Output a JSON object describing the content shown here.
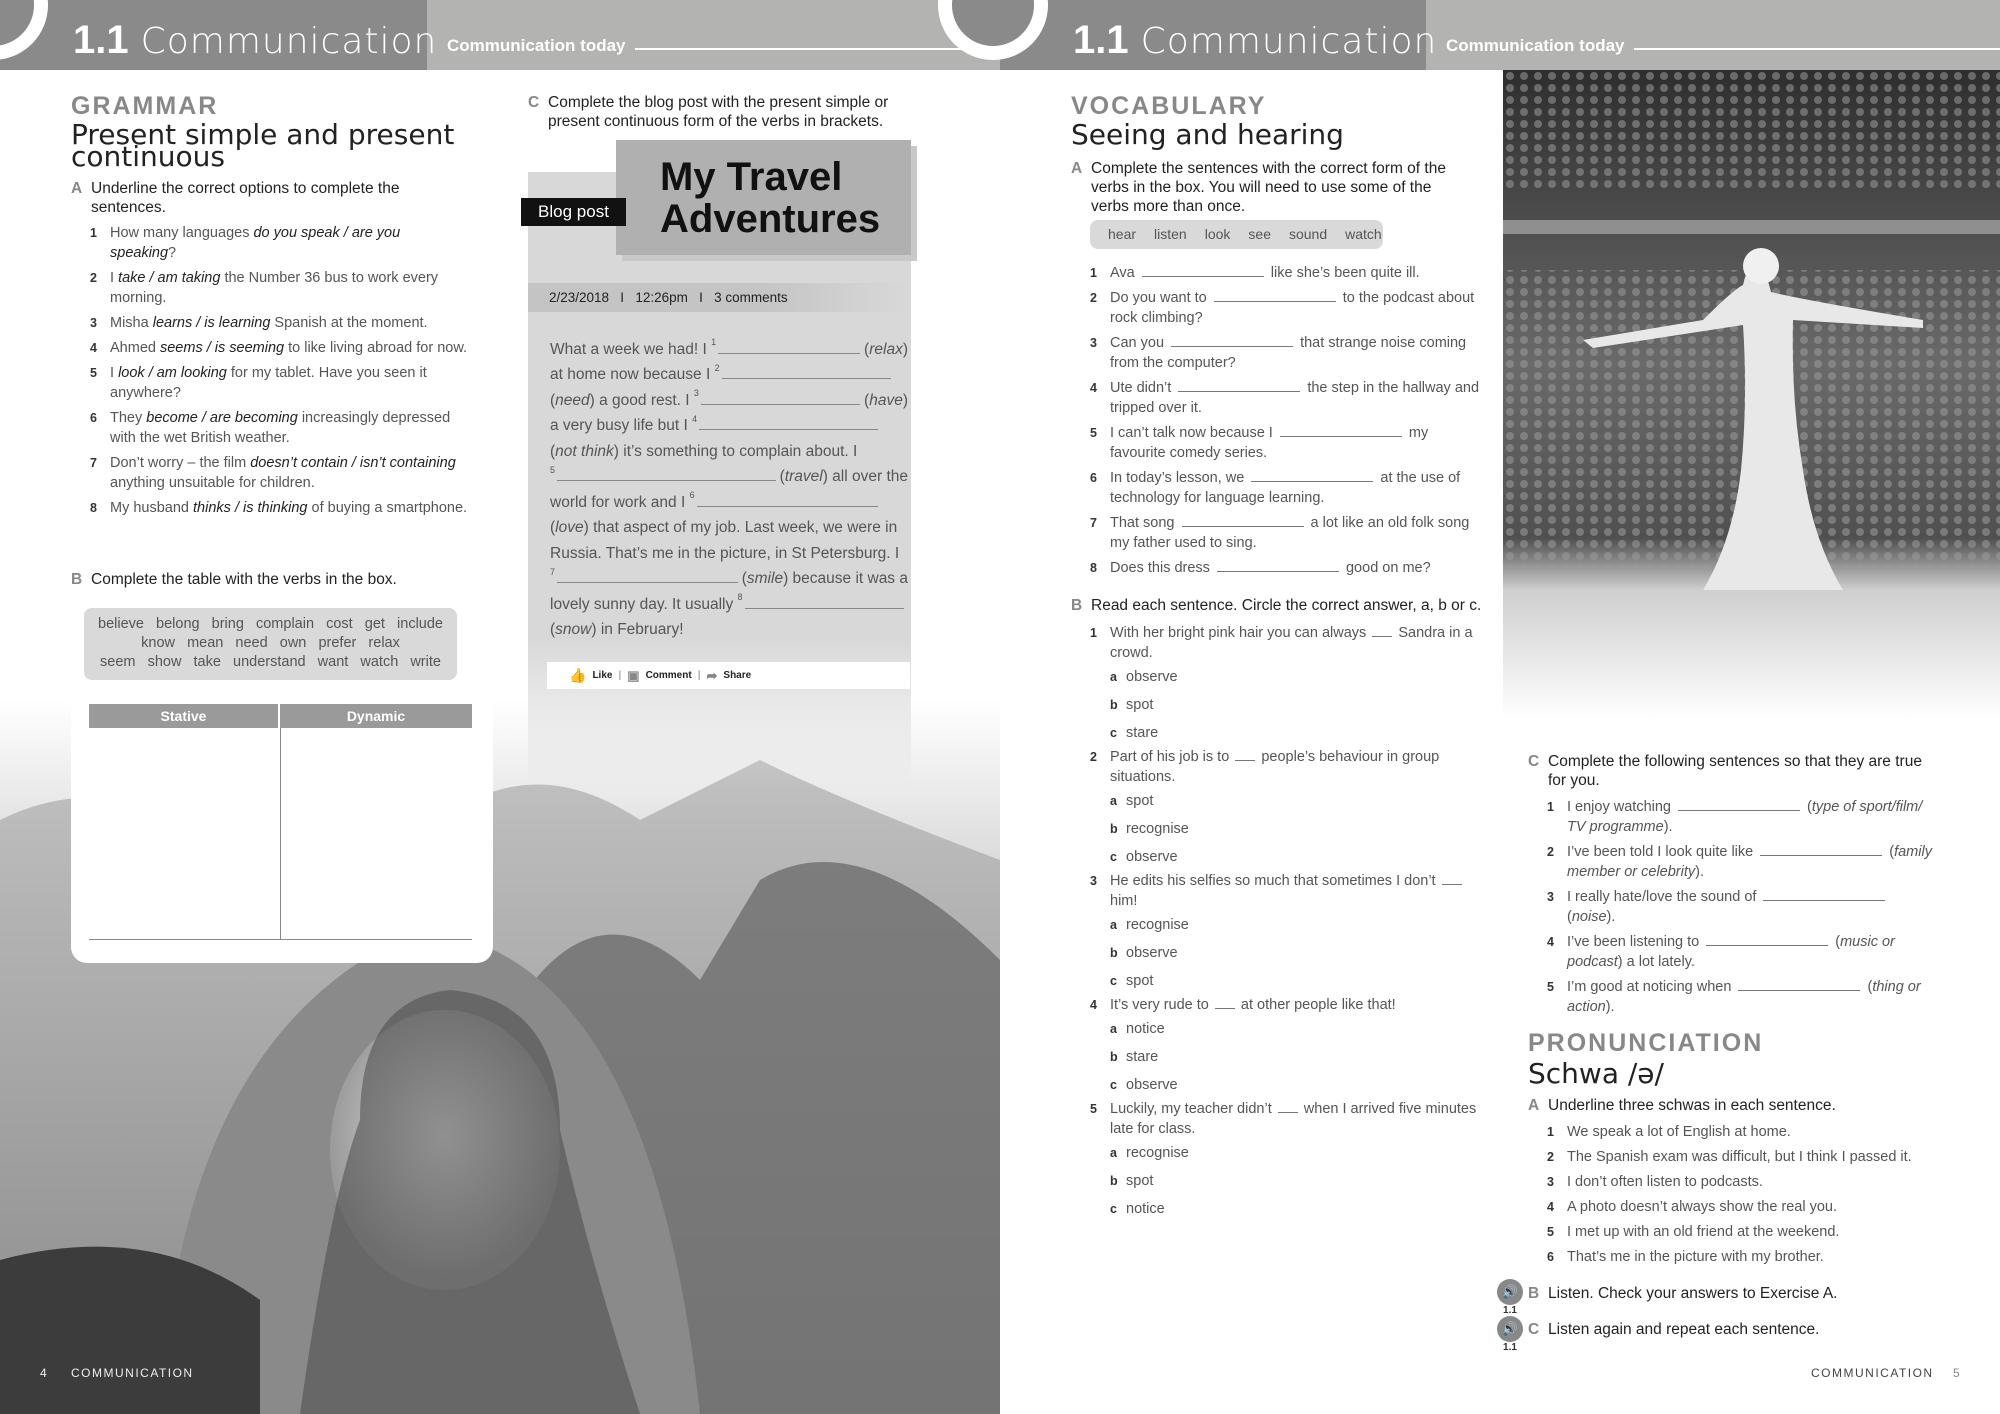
{
  "header": {
    "unit": "1.1",
    "title": "Communication",
    "subtitle": "Communication today"
  },
  "grammar": {
    "section": "GRAMMAR",
    "title_lines": [
      "Present simple and present",
      "continuous"
    ],
    "A": {
      "letter": "A",
      "text": "Underline the correct options to complete the  sentences.",
      "items": [
        {
          "pre": "How many languages ",
          "opt": "do you speak / are you speaking",
          "post": "?"
        },
        {
          "pre": "I ",
          "opt": "take / am taking",
          "post": " the Number 36 bus to work every morning."
        },
        {
          "pre": "Misha ",
          "opt": "learns / is learning",
          "post": " Spanish at the moment."
        },
        {
          "pre": "Ahmed ",
          "opt": "seems / is seeming",
          "post": " to like living abroad for now."
        },
        {
          "pre": "I ",
          "opt": "look / am looking",
          "post": " for my tablet. Have you seen it anywhere?"
        },
        {
          "pre": "They ",
          "opt": "become / are becoming",
          "post": " increasingly depressed with the wet British weather."
        },
        {
          "pre": "Don’t worry – the film ",
          "opt": "doesn’t contain / isn’t containing",
          "post": " anything unsuitable for children."
        },
        {
          "pre": "My husband ",
          "opt": "thinks / is thinking",
          "post": " of buying a smartphone."
        }
      ]
    },
    "B": {
      "letter": "B",
      "text": "Complete the table with the verbs in the box.",
      "verb_lines": [
        "believe   belong   bring   complain   cost   get   include",
        "know   mean   need   own   prefer   relax",
        "seem   show   take   understand   want   watch   write"
      ],
      "table_headers": [
        "Stative",
        "Dynamic"
      ]
    },
    "C": {
      "letter": "C",
      "text": "Complete the blog post with the present simple or present continuous form of the verbs in brackets."
    }
  },
  "blog": {
    "tag": "Blog post",
    "title_lines": [
      "My Travel",
      "Adventures"
    ],
    "meta": "2/23/2018   I   12:26pm   I   3 comments",
    "lines": [
      [
        {
          "t": "What a week we had! I "
        },
        {
          "s": "1"
        },
        {
          "g": 1
        },
        {
          "t": "("
        },
        {
          "i": "relax"
        },
        {
          "t": ")"
        }
      ],
      [
        {
          "t": "at home now because I "
        },
        {
          "s": "2"
        },
        {
          "g": 1
        },
        {
          "t": "   "
        }
      ],
      [
        {
          "t": "("
        },
        {
          "i": "need"
        },
        {
          "t": ") a good rest. I "
        },
        {
          "s": "3"
        },
        {
          "g": 1
        },
        {
          "t": "("
        },
        {
          "i": "have"
        },
        {
          "t": ")"
        }
      ],
      [
        {
          "t": "a very busy life but I "
        },
        {
          "s": "4"
        },
        {
          "g": 1
        },
        {
          "t": "      "
        }
      ],
      [
        {
          "t": "("
        },
        {
          "i": "not think"
        },
        {
          "t": ") it’s something to complain about. I"
        }
      ],
      [
        {
          "s": "5"
        },
        {
          "g": 1
        },
        {
          "t": "("
        },
        {
          "i": "travel"
        },
        {
          "t": ") all over the"
        }
      ],
      [
        {
          "t": "world for work and I "
        },
        {
          "s": "6"
        },
        {
          "g": 1
        },
        {
          "t": "      "
        }
      ],
      [
        {
          "t": "("
        },
        {
          "i": "love"
        },
        {
          "t": ") that aspect of my job. Last week, we were in"
        }
      ],
      [
        {
          "t": "Russia. That’s me in the picture, in St Petersburg. I"
        }
      ],
      [
        {
          "s": "7"
        },
        {
          "g": 1
        },
        {
          "t": "("
        },
        {
          "i": "smile"
        },
        {
          "t": ") because it was a"
        }
      ],
      [
        {
          "t": "lovely sunny day. It usually "
        },
        {
          "s": "8"
        },
        {
          "g": 1
        }
      ],
      [
        {
          "t": "("
        },
        {
          "i": "snow"
        },
        {
          "t": ") in February!"
        }
      ]
    ],
    "actions": [
      "Like",
      "Comment",
      "Share"
    ]
  },
  "vocab": {
    "section": "VOCABULARY",
    "title": "Seeing and hearing",
    "A": {
      "letter": "A",
      "text": "Complete the sentences with the correct form of the verbs in the box. You will need to use some of the verbs more than once.",
      "words": [
        "hear",
        "listen",
        "look",
        "see",
        "sound",
        "watch"
      ],
      "items": [
        {
          "pre": "Ava ",
          "post": " like she’s been quite ill."
        },
        {
          "pre": "Do you want to ",
          "post": " to the podcast about rock climbing?"
        },
        {
          "pre": "Can you ",
          "post": " that strange noise coming from the computer?"
        },
        {
          "pre": "Ute didn’t ",
          "post": " the step in the hallway and tripped over it."
        },
        {
          "pre": "I can’t talk now because I ",
          "post": " my favourite comedy series."
        },
        {
          "pre": "In today’s lesson, we ",
          "post": " at the use of technology for language learning."
        },
        {
          "pre": "That song ",
          "post": " a lot like an old folk song my father used to sing."
        },
        {
          "pre": "Does this dress ",
          "post": " good on me?"
        }
      ]
    },
    "B": {
      "letter": "B",
      "text": "Read each sentence. Circle the correct answer, a, b or c.",
      "items": [
        {
          "pre": "With her bright pink hair you can always ",
          "post": " Sandra in a crowd.",
          "options": [
            "observe",
            "spot",
            "stare"
          ]
        },
        {
          "pre": "Part of his job is to ",
          "post": " people’s behaviour in group situations.",
          "options": [
            "spot",
            "recognise",
            "observe"
          ]
        },
        {
          "pre": "He edits his selfies so much that sometimes I don’t ",
          "post": " him!",
          "options": [
            "recognise",
            "observe",
            "spot"
          ]
        },
        {
          "pre": "It’s very rude to ",
          "post": " at other people like that!",
          "options": [
            "notice",
            "stare",
            "observe"
          ]
        },
        {
          "pre": "Luckily, my teacher didn’t ",
          "post": " when I arrived five minutes late for class.",
          "options": [
            "recognise",
            "spot",
            "notice"
          ]
        }
      ]
    },
    "C": {
      "letter": "C",
      "text": "Complete the following sentences so that they are true for you.",
      "items": [
        {
          "pre": "I enjoy watching ",
          "hint": "type of sport/film/ TV programme",
          "post": "."
        },
        {
          "pre": "I’ve been told I look quite like ",
          "hint": "family member or celebrity",
          "post": "."
        },
        {
          "pre": "I really hate/love the sound of ",
          "hint": "noise",
          "post": "."
        },
        {
          "pre": "I’ve been listening to ",
          "hint": "music or podcast",
          "post": " a lot lately."
        },
        {
          "pre": "I’m good at noticing when ",
          "hint": "thing or action",
          "post": "."
        }
      ]
    }
  },
  "pron": {
    "section": "PRONUNCIATION",
    "title": "Schwa /ə/",
    "A": {
      "letter": "A",
      "text": "Underline three schwas in each sentence.",
      "items": [
        "We speak a lot of English at home.",
        "The Spanish exam was difficult, but I think I passed it.",
        "I don’t often listen to podcasts.",
        "A photo doesn’t always show the real you.",
        "I met up with an old friend at the weekend.",
        "That’s me in the picture with my brother."
      ]
    },
    "B": {
      "letter": "B",
      "text": "Listen. Check your answers to Exercise A.",
      "track": "1.1"
    },
    "C": {
      "letter": "C",
      "text": "Listen again and repeat each sentence.",
      "track": "1.1"
    }
  },
  "footer": {
    "left_page": "4",
    "left_label": "COMMUNICATION",
    "right_label": "COMMUNICATION",
    "right_page": "5"
  },
  "colors": {
    "header_dark": "#8a8a8a",
    "header_light": "#b3b3b1",
    "box": "#d9d9d9",
    "blog_bg": "#d8d8d8"
  },
  "icons": [
    "thumbs-up-icon",
    "comment-icon",
    "share-arrow-icon",
    "speaker-icon"
  ]
}
